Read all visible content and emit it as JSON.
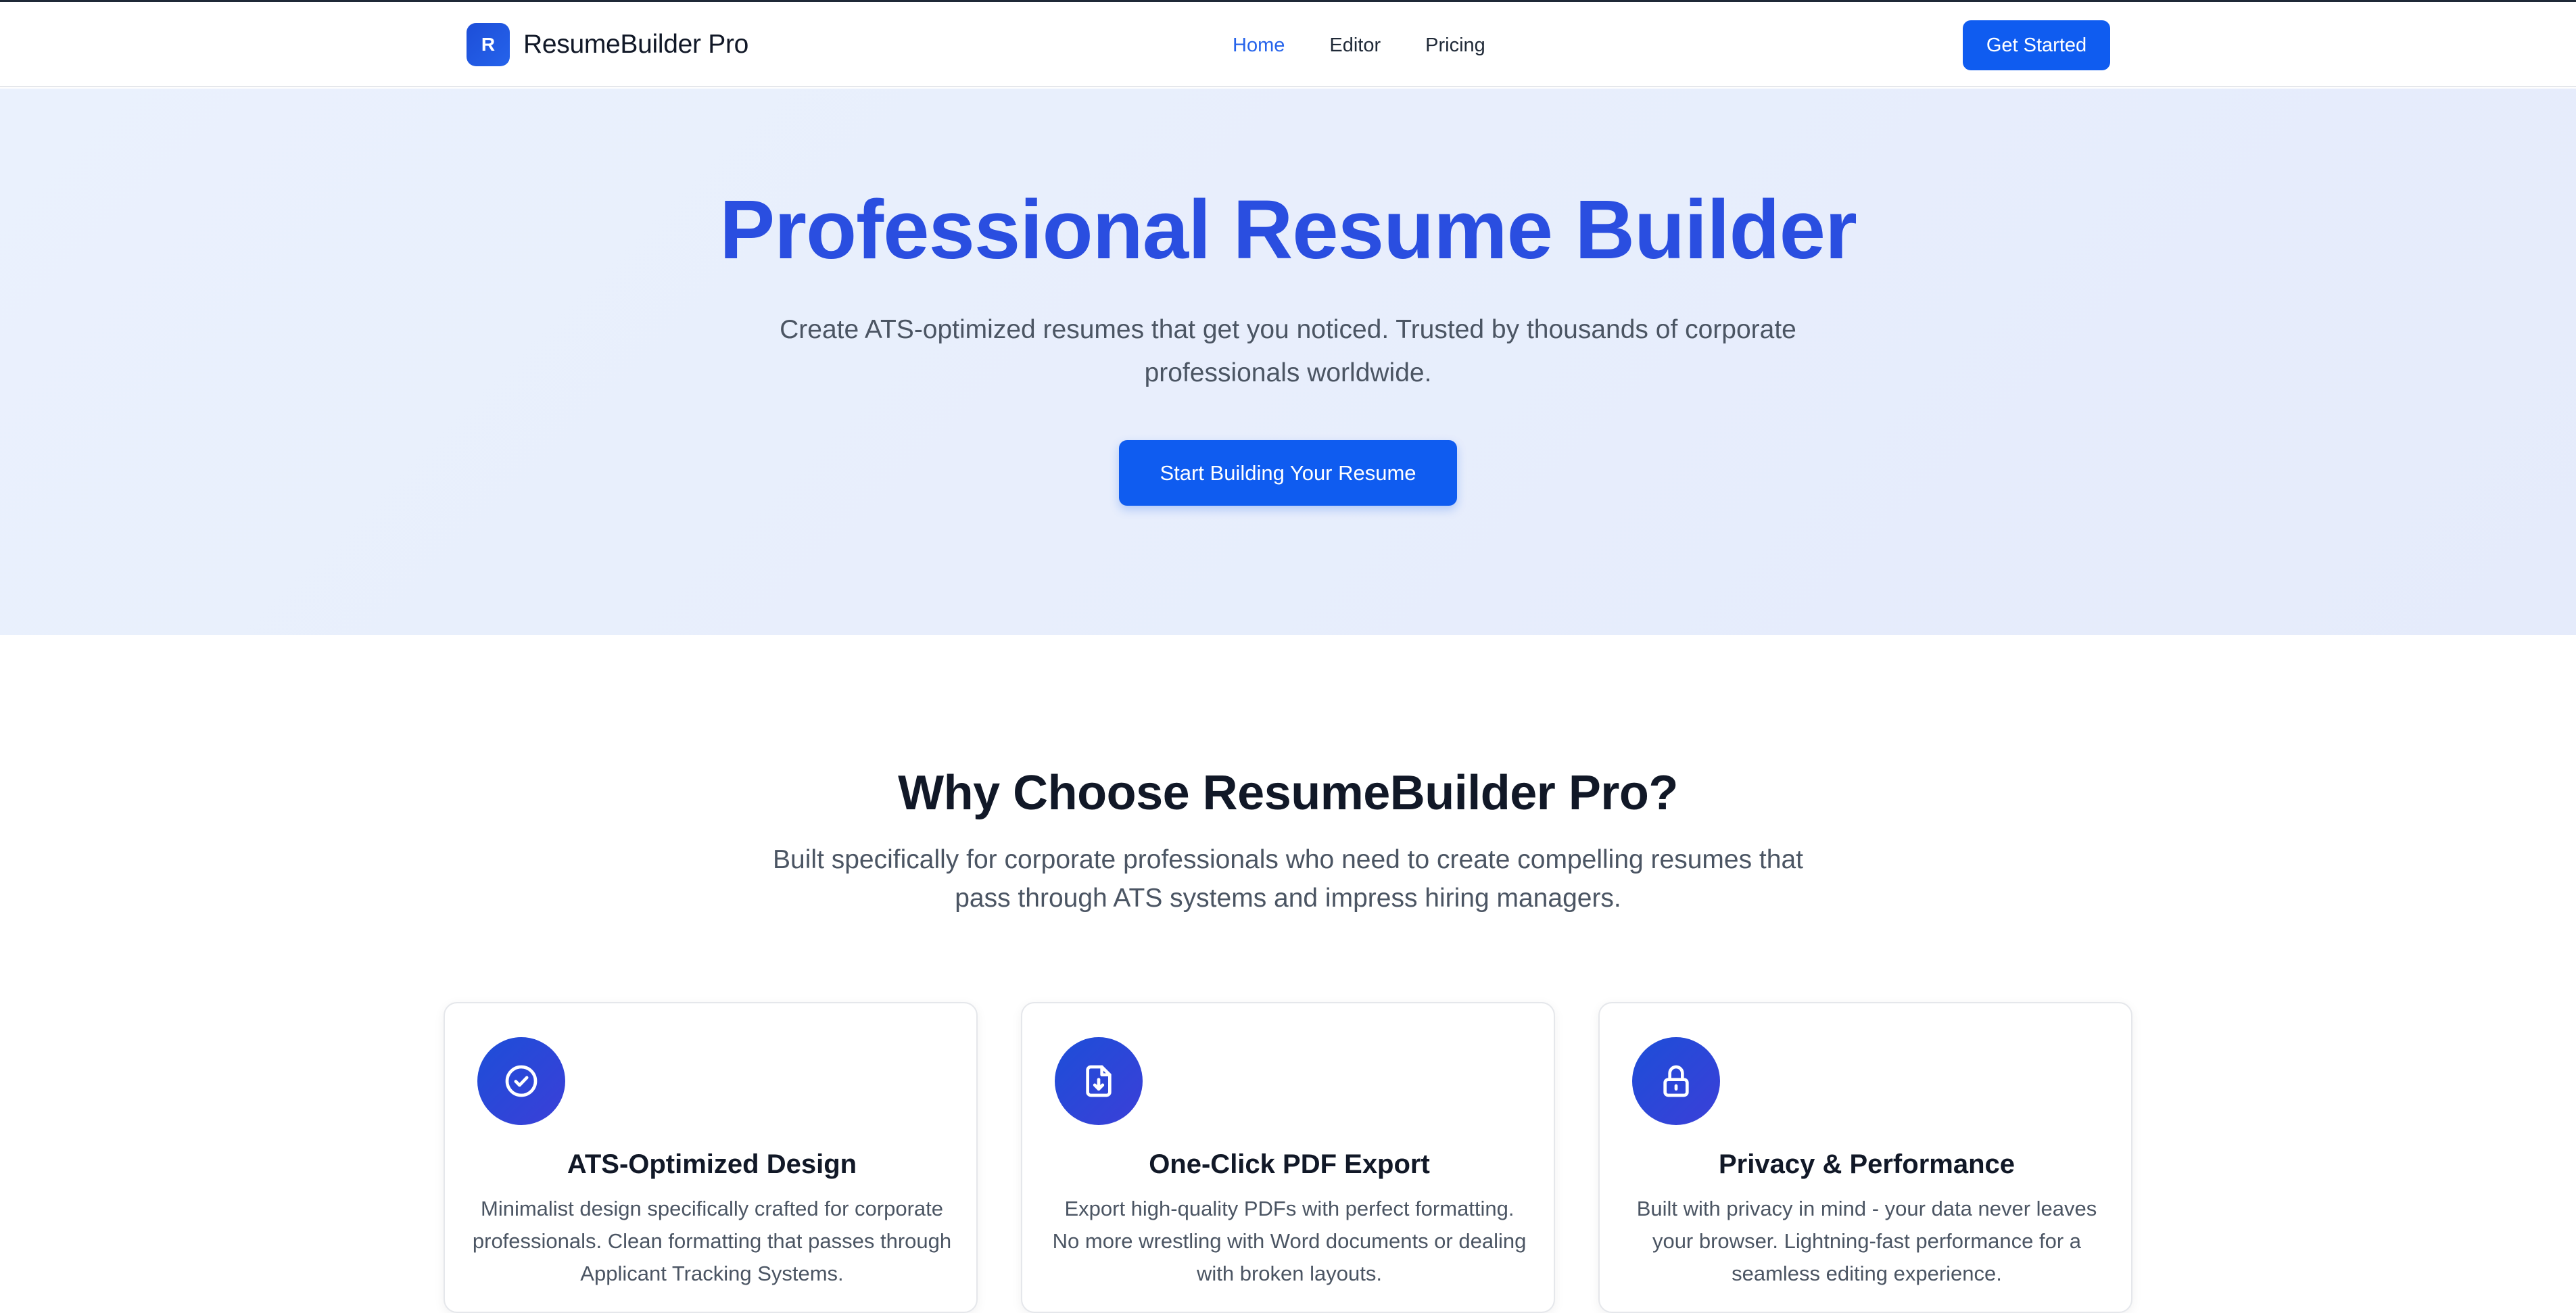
{
  "brand": {
    "logo_letter": "R",
    "name": "ResumeBuilder Pro"
  },
  "nav": {
    "links": [
      {
        "label": "Home",
        "active": true
      },
      {
        "label": "Editor",
        "active": false
      },
      {
        "label": "Pricing",
        "active": false
      }
    ],
    "cta_label": "Get Started"
  },
  "hero": {
    "title": "Professional Resume Builder",
    "subtitle": "Create ATS-optimized resumes that get you noticed. Trusted by thousands of corporate professionals worldwide.",
    "cta_label": "Start Building Your Resume"
  },
  "features": {
    "title": "Why Choose ResumeBuilder Pro?",
    "subtitle": "Built specifically for corporate professionals who need to create compelling resumes that pass through ATS systems and impress hiring managers.",
    "cards": [
      {
        "icon": "check-circle-icon",
        "title": "ATS-Optimized Design",
        "text": "Minimalist design specifically crafted for corporate professionals. Clean formatting that passes through Applicant Tracking Systems."
      },
      {
        "icon": "file-download-icon",
        "title": "One-Click PDF Export",
        "text": "Export high-quality PDFs with perfect formatting. No more wrestling with Word documents or dealing with broken layouts."
      },
      {
        "icon": "lock-icon",
        "title": "Privacy & Performance",
        "text": "Built with privacy in mind - your data never leaves your browser. Lightning-fast performance for a seamless editing experience."
      }
    ]
  },
  "colors": {
    "primary": "#0f5cf0",
    "hero_title": "#2a4ee0",
    "hero_bg": "#eaf1fd"
  }
}
